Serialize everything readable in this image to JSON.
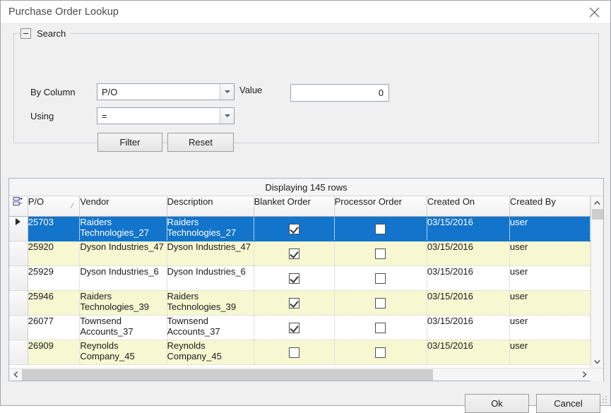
{
  "window": {
    "title": "Purchase Order Lookup",
    "close_icon": "close-icon"
  },
  "search": {
    "group_title": "Search",
    "collapse_icon": "minus-icon",
    "by_column_label": "By Column",
    "by_column_value": "P/O",
    "using_label": "Using",
    "using_value": "=",
    "value_label": "Value",
    "value_text": "0",
    "filter_label": "Filter",
    "reset_label": "Reset",
    "dropdown_icon": "chevron-down-icon"
  },
  "grid": {
    "caption": "Displaying 145 rows",
    "corner_icon": "select-all-grid-icon",
    "sort_indicator": "⁄",
    "columns": [
      {
        "key": "po",
        "label": "P/O",
        "sorted": true
      },
      {
        "key": "vendor",
        "label": "Vendor",
        "sorted": false
      },
      {
        "key": "description",
        "label": "Description",
        "sorted": false
      },
      {
        "key": "blanket_order",
        "label": "Blanket Order",
        "sorted": false
      },
      {
        "key": "processor_order",
        "label": "Processor Order",
        "sorted": false
      },
      {
        "key": "created_on",
        "label": "Created On",
        "sorted": false
      },
      {
        "key": "created_by",
        "label": "Created By",
        "sorted": false
      }
    ],
    "rows": [
      {
        "po": "25703",
        "vendor": "Raiders Technologies_27",
        "description": "Raiders Technologies_27",
        "blanket_order": true,
        "processor_order": false,
        "created_on": "03/15/2016",
        "created_by": "user",
        "selected": true,
        "alt": false
      },
      {
        "po": "25920",
        "vendor": "Dyson Industries_47",
        "description": "Dyson Industries_47",
        "blanket_order": true,
        "processor_order": false,
        "created_on": "03/15/2016",
        "created_by": "user",
        "selected": false,
        "alt": true
      },
      {
        "po": "25929",
        "vendor": "Dyson Industries_6",
        "description": "Dyson Industries_6",
        "blanket_order": true,
        "processor_order": false,
        "created_on": "03/15/2016",
        "created_by": "user",
        "selected": false,
        "alt": false
      },
      {
        "po": "25946",
        "vendor": "Raiders Technologies_39",
        "description": "Raiders Technologies_39",
        "blanket_order": true,
        "processor_order": false,
        "created_on": "03/15/2016",
        "created_by": "user",
        "selected": false,
        "alt": true
      },
      {
        "po": "26077",
        "vendor": "Townsend Accounts_37",
        "description": "Townsend Accounts_37",
        "blanket_order": true,
        "processor_order": false,
        "created_on": "03/15/2016",
        "created_by": "user",
        "selected": false,
        "alt": false
      },
      {
        "po": "26909",
        "vendor": "Reynolds Company_45",
        "description": "Reynolds Company_45",
        "blanket_order": false,
        "processor_order": false,
        "created_on": "03/15/2016",
        "created_by": "user",
        "selected": false,
        "alt": true
      }
    ],
    "scroll_up_icon": "chevron-up-icon",
    "scroll_down_icon": "chevron-down-icon",
    "scroll_left_icon": "chevron-left-icon",
    "scroll_right_icon": "chevron-right-icon"
  },
  "footer": {
    "ok_label": "Ok",
    "cancel_label": "Cancel",
    "resize_grip_icon": "resize-grip-icon"
  },
  "colors": {
    "selection_blue": "#1274cb",
    "alt_row_yellow": "#f7f7d2",
    "window_bg": "#f0f0f0"
  }
}
